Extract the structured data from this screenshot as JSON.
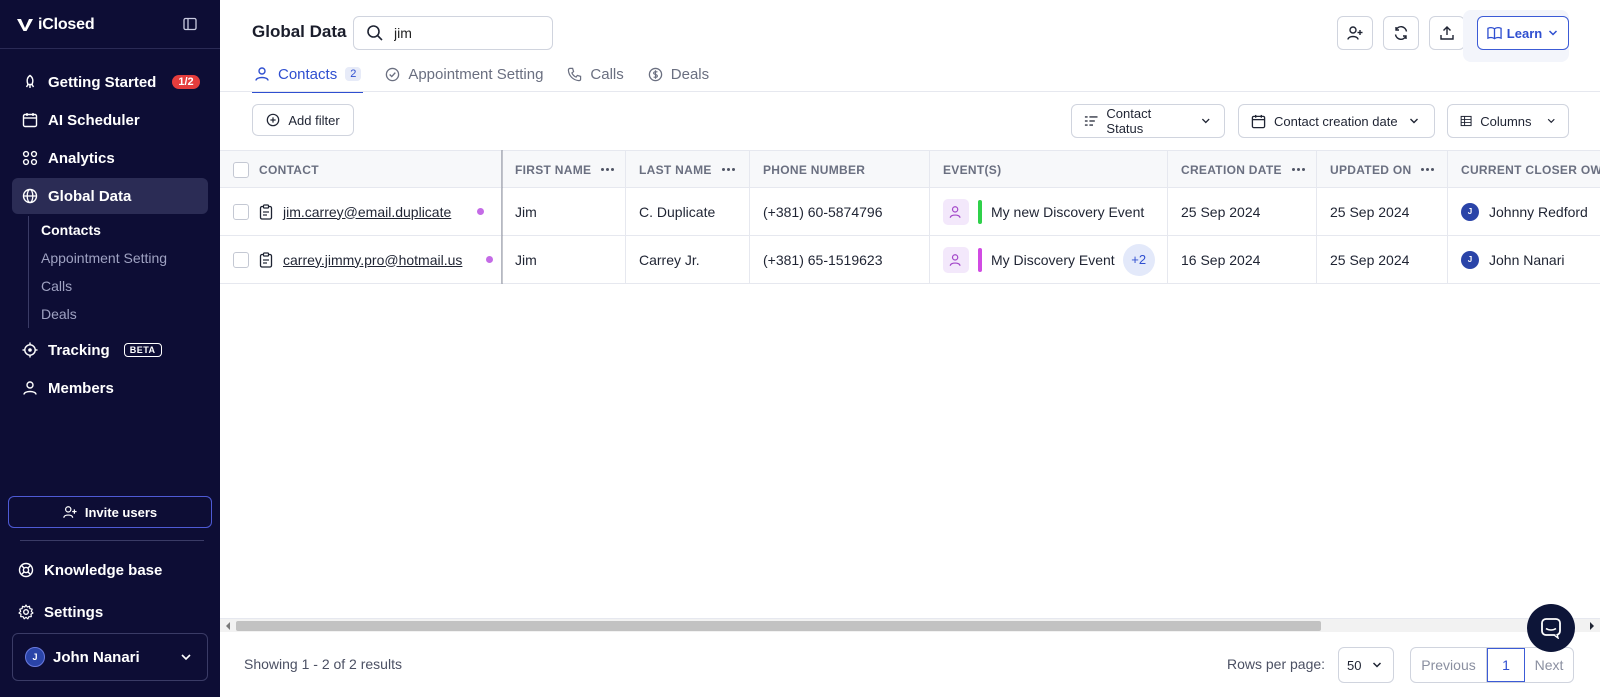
{
  "brand": {
    "name": "iClosed"
  },
  "sidebar": {
    "items": [
      {
        "label": "Getting Started",
        "badge": "1/2",
        "icon": "rocket-icon"
      },
      {
        "label": "AI Scheduler",
        "icon": "calendar-icon"
      },
      {
        "label": "Analytics",
        "icon": "analytics-icon"
      },
      {
        "label": "Global Data",
        "icon": "globe-icon",
        "active": true
      },
      {
        "label": "Tracking",
        "badge": "BETA",
        "icon": "target-icon"
      },
      {
        "label": "Members",
        "icon": "users-icon"
      }
    ],
    "subitems": [
      "Contacts",
      "Appointment Setting",
      "Calls",
      "Deals"
    ],
    "invite_label": "Invite users",
    "bottom": [
      {
        "label": "Knowledge base",
        "icon": "lifebuoy-icon"
      },
      {
        "label": "Settings",
        "icon": "gear-icon"
      }
    ],
    "user": {
      "initial": "J",
      "name": "John Nanari"
    }
  },
  "header": {
    "title": "Global Data",
    "search_value": "jim",
    "learn_label": "Learn"
  },
  "tabs": [
    {
      "label": "Contacts",
      "count": "2",
      "active": true
    },
    {
      "label": "Appointment Setting"
    },
    {
      "label": "Calls"
    },
    {
      "label": "Deals"
    }
  ],
  "filters": {
    "add_filter": "Add filter",
    "contact_status": "Contact Status",
    "creation_date": "Contact creation date",
    "columns": "Columns"
  },
  "table": {
    "headers": [
      "CONTACT",
      "FIRST NAME",
      "LAST NAME",
      "PHONE NUMBER",
      "EVENT(S)",
      "CREATION DATE",
      "UPDATED ON",
      "CURRENT CLOSER OWNER"
    ],
    "rows": [
      {
        "email": "jim.carrey@email.duplicate",
        "first_name": "Jim",
        "last_name": "C. Duplicate",
        "phone": "(+381) 60-5874796",
        "event": "My new Discovery Event",
        "event_color": "#2fd14a",
        "extra_events": "",
        "created": "25 Sep 2024",
        "updated": "25 Sep 2024",
        "owner_initial": "J",
        "owner": "Johnny Redford"
      },
      {
        "email": "carrey.jimmy.pro@hotmail.us",
        "first_name": "Jim",
        "last_name": "Carrey Jr.",
        "phone": "(+381) 65-1519623",
        "event": "My Discovery Event",
        "event_color": "#d14be3",
        "extra_events": "+2",
        "created": "16 Sep 2024",
        "updated": "25 Sep 2024",
        "owner_initial": "J",
        "owner": "John Nanari"
      }
    ]
  },
  "footer": {
    "showing": "Showing 1 - 2 of 2 results",
    "rows_label": "Rows per page:",
    "rows_value": "50",
    "prev": "Previous",
    "page": "1",
    "next": "Next"
  },
  "colors": {
    "sidebar_bg": "#0d0d35",
    "accent": "#2f4fd0",
    "badge_red": "#e53d3d"
  }
}
